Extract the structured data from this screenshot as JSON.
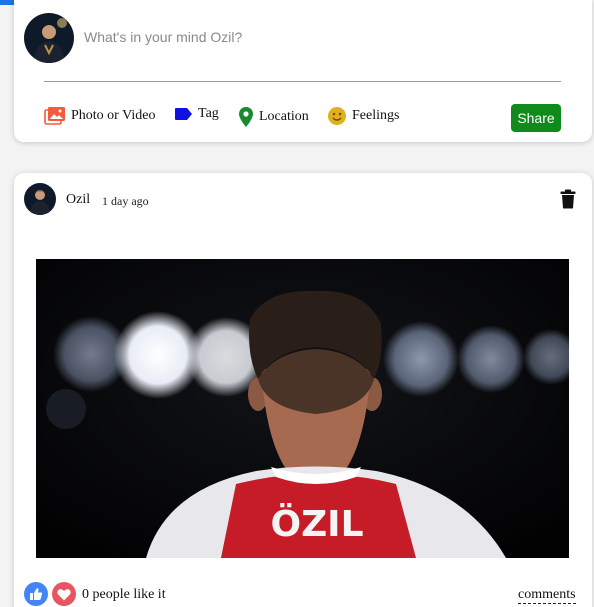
{
  "composer": {
    "placeholder": "What's in your mind Ozil?",
    "options": {
      "photo": "Photo or Video",
      "tag": "Tag",
      "location": "Location",
      "feelings": "Feelings"
    },
    "share_label": "Share"
  },
  "post": {
    "username": "Ozil",
    "time": "1 day ago",
    "jersey_text": "ÖZIL",
    "likes_text": "0 people like it",
    "comments_label": "comments"
  },
  "colors": {
    "accent": "#1a73e8",
    "share_button": "#108a1a",
    "photo_icon": "#f25c3a",
    "tag_icon": "#1010e0",
    "location_icon": "#1a8a2e",
    "feelings_icon": "#e0b020",
    "like_thumb": "#4285f4",
    "like_heart": "#e85462"
  },
  "icons": [
    "photo-icon",
    "tag-icon",
    "location-icon",
    "feelings-icon",
    "trash-icon",
    "thumbs-up-icon",
    "heart-icon"
  ]
}
